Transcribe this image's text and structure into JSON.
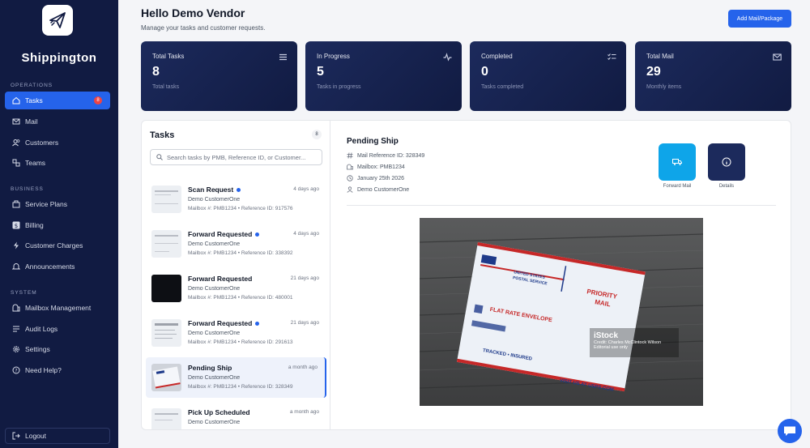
{
  "sidebar": {
    "brand": "Shippington",
    "sections": [
      {
        "label": "OPERATIONS"
      },
      {
        "label": "BUSINESS"
      },
      {
        "label": "SYSTEM"
      }
    ],
    "items": [
      {
        "label": "Tasks",
        "icon": "home-icon",
        "badge": "8"
      },
      {
        "label": "Mail",
        "icon": "mail-icon"
      },
      {
        "label": "Customers",
        "icon": "users-icon"
      },
      {
        "label": "Teams",
        "icon": "teams-icon"
      },
      {
        "label": "Service Plans",
        "icon": "plans-icon"
      },
      {
        "label": "Billing",
        "icon": "dollar-icon"
      },
      {
        "label": "Customer Charges",
        "icon": "bolt-icon"
      },
      {
        "label": "Announcements",
        "icon": "bell-icon"
      },
      {
        "label": "Mailbox Management",
        "icon": "mailbox-icon"
      },
      {
        "label": "Audit Logs",
        "icon": "list-icon"
      },
      {
        "label": "Settings",
        "icon": "gear-icon"
      },
      {
        "label": "Need Help?",
        "icon": "help-icon"
      }
    ],
    "logout": "Logout",
    "accent": "#2563eb",
    "bg": "#111b42"
  },
  "header": {
    "title": "Hello Demo Vendor",
    "subtitle": "Manage your tasks and customer requests.",
    "add_button": "Add Mail/Package"
  },
  "stats": [
    {
      "title": "Total Tasks",
      "value": "8",
      "sub": "Total tasks",
      "icon": "list-icon"
    },
    {
      "title": "In Progress",
      "value": "5",
      "sub": "Tasks in progress",
      "icon": "activity-icon"
    },
    {
      "title": "Completed",
      "value": "0",
      "sub": "Tasks completed",
      "icon": "checklist-icon"
    },
    {
      "title": "Total Mail",
      "value": "29",
      "sub": "Monthly items",
      "icon": "mail-icon"
    }
  ],
  "tasks": {
    "title": "Tasks",
    "count": "8",
    "search_placeholder": "Search tasks by PMB, Reference ID, or Customer...",
    "items": [
      {
        "title": "Scan Request",
        "time": "4 days ago",
        "customer": "Demo CustomerOne",
        "meta": "Mailbox #: PMB1234 • Reference ID: 917576",
        "unread": true
      },
      {
        "title": "Forward Requested",
        "time": "4 days ago",
        "customer": "Demo CustomerOne",
        "meta": "Mailbox #: PMB1234 • Reference ID: 338392",
        "unread": true
      },
      {
        "title": "Forward Requested",
        "time": "21 days ago",
        "customer": "Demo CustomerOne",
        "meta": "Mailbox #: PMB1234 • Reference ID: 480001",
        "unread": false
      },
      {
        "title": "Forward Requested",
        "time": "21 days ago",
        "customer": "Demo CustomerOne",
        "meta": "Mailbox #: PMB1234 • Reference ID: 291613",
        "unread": true
      },
      {
        "title": "Pending Ship",
        "time": "a month ago",
        "customer": "Demo CustomerOne",
        "meta": "Mailbox #: PMB1234 • Reference ID: 328349",
        "unread": false
      },
      {
        "title": "Pick Up Scheduled",
        "time": "a month ago",
        "customer": "Demo CustomerOne",
        "meta": "",
        "unread": false
      }
    ]
  },
  "detail": {
    "title": "Pending Ship",
    "reference": "Mail Reference ID: 328349",
    "mailbox": "Mailbox: PMB1234",
    "date": "January 25th 2026",
    "customer": "Demo CustomerOne",
    "actions": [
      {
        "label": "Forward Mail",
        "color": "#0ea5e9"
      },
      {
        "label": "Details",
        "color": "#1c2a5c"
      }
    ],
    "photo": {
      "envelope_line1": "UNITED STATES",
      "envelope_line2": "POSTAL SERVICE",
      "priority": "PRIORITY",
      "mail": "MAIL",
      "flat_rate": "FLAT RATE ENVELOPE",
      "tracked": "TRACKED • INSURED",
      "visit": "VISIT US AT USPS.COM",
      "stock_brand": "iStock",
      "credit": "Credit: Charles McClintock Wilson",
      "editorial": "Editorial use only"
    }
  }
}
